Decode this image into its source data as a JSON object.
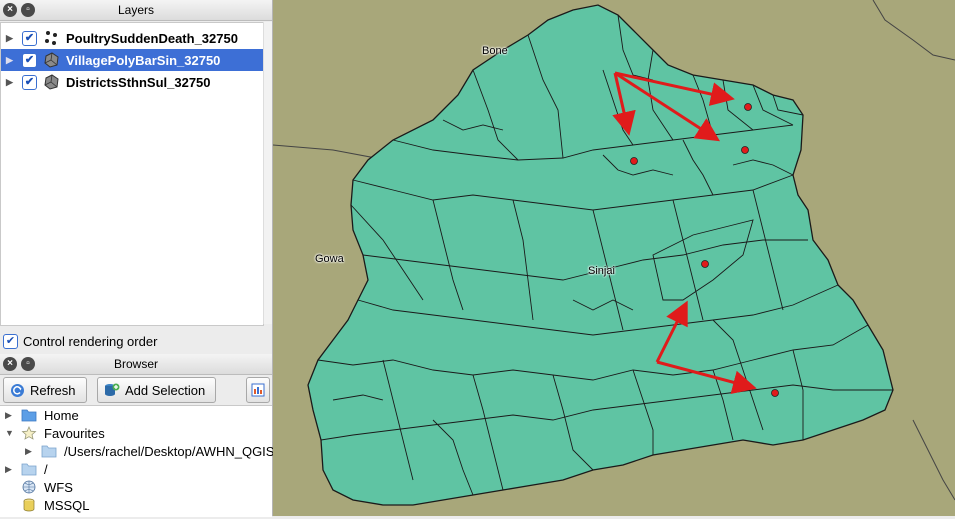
{
  "layers_panel": {
    "title": "Layers",
    "items": [
      {
        "name": "PoultrySuddenDeath_32750",
        "checked": true,
        "icon": "point-layer-icon"
      },
      {
        "name": "VillagePolyBarSin_32750",
        "checked": true,
        "icon": "polygon-layer-icon",
        "selected": true
      },
      {
        "name": "DistrictsSthnSul_32750",
        "checked": true,
        "icon": "polygon-layer-icon"
      }
    ],
    "control_rendering_label": "Control rendering order"
  },
  "browser_panel": {
    "title": "Browser",
    "refresh_label": "Refresh",
    "add_selection_label": "Add Selection",
    "items": [
      {
        "label": "Home"
      },
      {
        "label": "Favourites"
      },
      {
        "label": "/Users/rachel/Desktop/AWHN_QGIS"
      },
      {
        "label": "/"
      },
      {
        "label": "WFS"
      },
      {
        "label": "MSSQL"
      }
    ]
  },
  "map": {
    "labels": {
      "bone": "Bone",
      "gowa": "Gowa",
      "sinjai": "Sinjai"
    },
    "colors": {
      "background": "#a8a77a",
      "polygon_fill": "#5fc4a3",
      "boundary": "#1a1a1a",
      "arrow": "#e01b1b",
      "point": "#e01b1b"
    }
  }
}
